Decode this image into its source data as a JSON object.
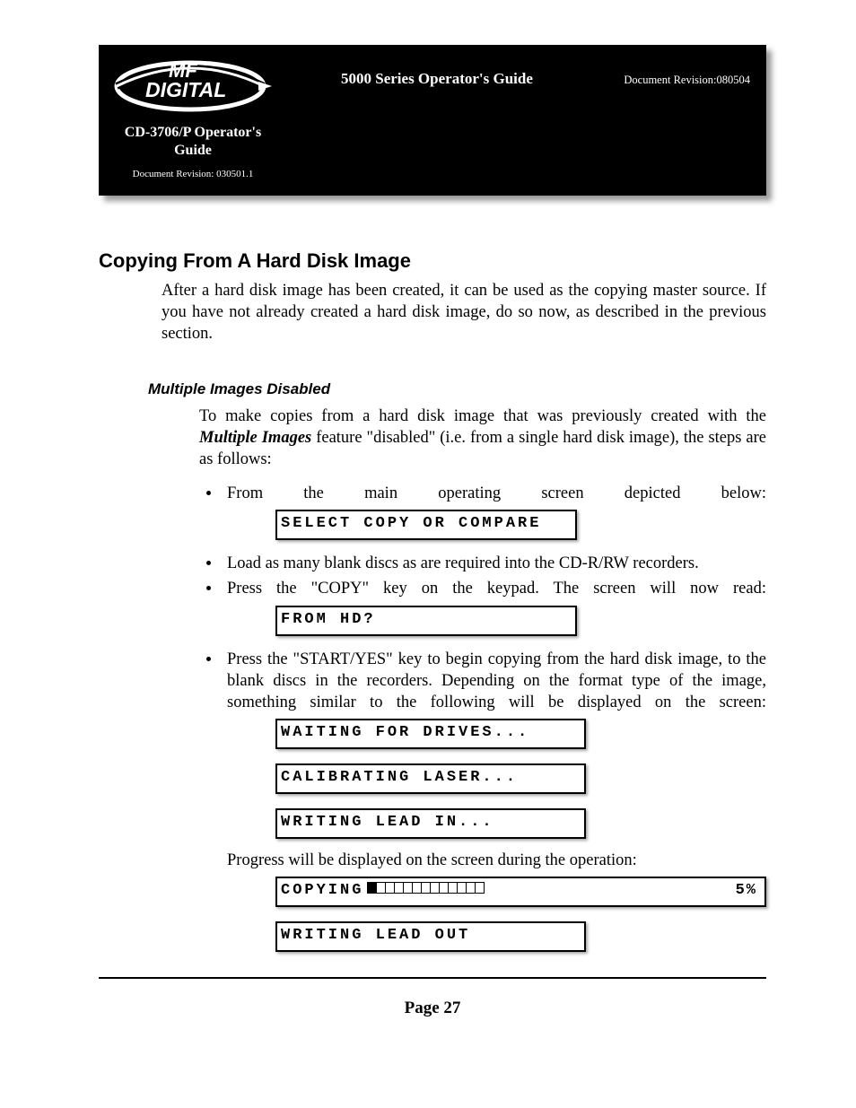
{
  "header": {
    "logo_line1": "MF",
    "logo_line2": "DIGITAL",
    "center_title": "5000 Series Operator's Guide",
    "right_rev": "Document Revision:080504",
    "sub_title_line1": "CD-3706/P Operator's",
    "sub_title_line2": "Guide",
    "sub_rev": "Document Revision: 030501.1"
  },
  "section": {
    "title": "Copying From A Hard Disk Image",
    "intro": "After a hard disk image has been created, it can be used as the copying master source. If you have not already created a hard disk image, do so now, as described in the previous section."
  },
  "subsection": {
    "title": "Multiple Images Disabled",
    "para_pre": "To make copies from a hard disk image that was previously created with the ",
    "feature": "Multiple Images",
    "para_post": " feature \"disabled\" (i.e. from a single hard disk image), the steps are as follows:"
  },
  "steps": {
    "s1": "From the main operating screen depicted below:",
    "lcd1": "SELECT COPY OR COMPARE",
    "s2": "Load as many blank discs as are required into the CD-R/RW recorders.",
    "s3": "Press the \"COPY\" key on the keypad. The screen will now read:",
    "lcd2": "FROM HD?",
    "s4": "Press the \"START/YES\" key to begin copying from the hard disk image, to the blank discs in the recorders. Depending on the format type of the image, something similar to the following will be displayed on the screen:",
    "lcd3": "WAITING FOR DRIVES...",
    "lcd4": "CALIBRATING LASER...",
    "lcd5": "WRITING LEAD IN...",
    "progress_text": "Progress will be displayed on the screen during the operation:",
    "lcd6_label": "COPYING",
    "lcd6_pct": "5%",
    "lcd7": "WRITING LEAD OUT"
  },
  "footer": {
    "page": "Page 27"
  }
}
